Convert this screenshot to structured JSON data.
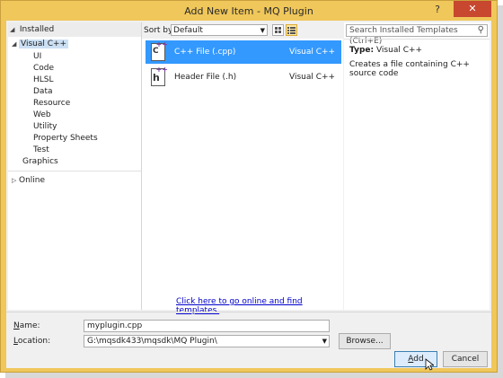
{
  "window": {
    "title": "Add New Item - MQ Plugin"
  },
  "titlebar": {
    "help": "?",
    "close": "✕"
  },
  "left": {
    "header": "Installed",
    "tree": [
      {
        "label": "Visual C++",
        "expanded": true,
        "selected": true
      },
      {
        "label": "UI"
      },
      {
        "label": "Code"
      },
      {
        "label": "HLSL"
      },
      {
        "label": "Data"
      },
      {
        "label": "Resource"
      },
      {
        "label": "Web"
      },
      {
        "label": "Utility"
      },
      {
        "label": "Property Sheets"
      },
      {
        "label": "Test"
      },
      {
        "label": "Graphics"
      }
    ],
    "online": "Online"
  },
  "middle": {
    "sort_label": "Sort by:",
    "sort_value": "Default",
    "templates": [
      {
        "name": "C++ File (.cpp)",
        "language": "Visual C++",
        "icon": "c++",
        "selected": true
      },
      {
        "name": "Header File (.h)",
        "language": "Visual C++",
        "icon": "h",
        "selected": false
      }
    ],
    "online_link": "Click here to go online and find templates."
  },
  "right": {
    "search_placeholder": "Search Installed Templates (Ctrl+E)",
    "type_label": "Type:",
    "type_value": "Visual C++",
    "description": "Creates a file containing C++ source code"
  },
  "bottom": {
    "name_label": "Name:",
    "name_value": "myplugin.cpp",
    "location_label": "Location:",
    "location_value": "G:\\mqsdk433\\mqsdk\\MQ Plugin\\",
    "browse": "Browse...",
    "add": "Add",
    "cancel": "Cancel"
  },
  "colors": {
    "frame": "#f0c75a",
    "selection": "#3399ff",
    "close": "#c7472f"
  }
}
